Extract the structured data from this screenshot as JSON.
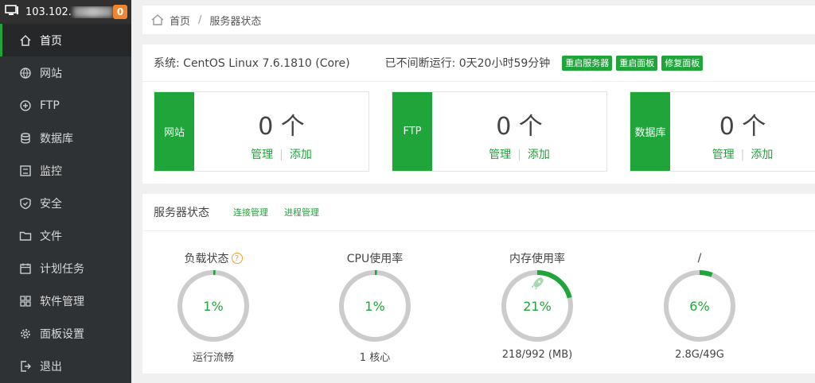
{
  "sidebar": {
    "ip": "103.102.",
    "badge": "0",
    "items": [
      {
        "label": "首页",
        "icon": "home-icon"
      },
      {
        "label": "网站",
        "icon": "globe-icon"
      },
      {
        "label": "FTP",
        "icon": "ftp-icon"
      },
      {
        "label": "数据库",
        "icon": "database-icon"
      },
      {
        "label": "监控",
        "icon": "monitor-icon"
      },
      {
        "label": "安全",
        "icon": "shield-icon"
      },
      {
        "label": "文件",
        "icon": "folder-icon"
      },
      {
        "label": "计划任务",
        "icon": "calendar-icon"
      },
      {
        "label": "软件管理",
        "icon": "apps-icon"
      },
      {
        "label": "面板设置",
        "icon": "gear-icon"
      },
      {
        "label": "退出",
        "icon": "logout-icon"
      }
    ]
  },
  "breadcrumb": {
    "home": "首页",
    "sep": "/",
    "current": "服务器状态"
  },
  "system": {
    "os": "系统: CentOS Linux 7.6.1810 (Core)",
    "uptime": "已不间断运行: 0天20小时59分钟",
    "buttons": [
      "重启服务器",
      "重启面板",
      "修复面板"
    ]
  },
  "stats": [
    {
      "tag": "网站",
      "count": "0 个",
      "manage": "管理",
      "add": "添加"
    },
    {
      "tag": "FTP",
      "count": "0 个",
      "manage": "管理",
      "add": "添加"
    },
    {
      "tag": "数据库",
      "count": "0 个",
      "manage": "管理",
      "add": "添加"
    }
  ],
  "server_status": {
    "title": "服务器状态",
    "links": [
      "连接管理",
      "进程管理"
    ],
    "gauges": [
      {
        "label": "负载状态",
        "percent": 1,
        "value": "1%",
        "sub": "运行流畅"
      },
      {
        "label": "CPU使用率",
        "percent": 1,
        "value": "1%",
        "sub": "1 核心"
      },
      {
        "label": "内存使用率",
        "percent": 21,
        "value": "21%",
        "sub": "218/992 (MB)"
      },
      {
        "label": "/",
        "percent": 6,
        "value": "6%",
        "sub": "2.8G/49G"
      }
    ]
  },
  "colors": {
    "accent": "#20a53a",
    "sidebar": "#2f3235",
    "badge": "#f0852d",
    "track": "#cccccc"
  }
}
